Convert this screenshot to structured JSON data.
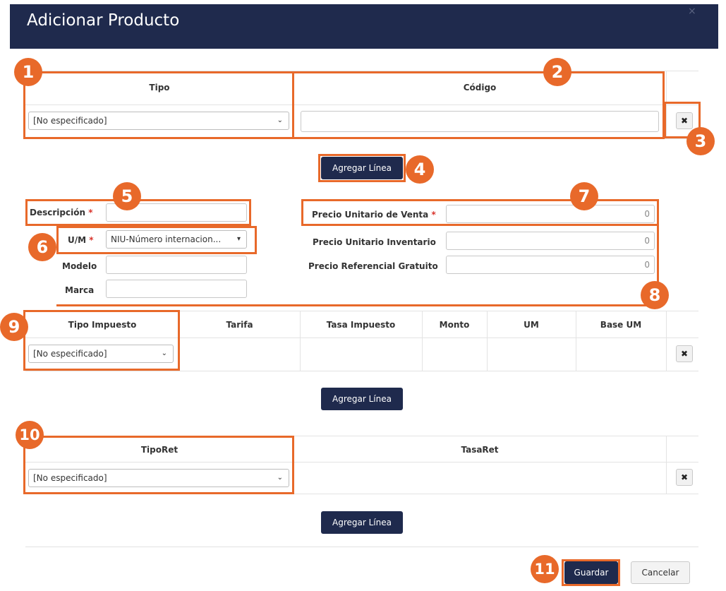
{
  "dialog": {
    "title": "Adicionar Producto",
    "close_label": "×"
  },
  "product_table": {
    "headers": [
      "Tipo",
      "Código"
    ],
    "tipo_value": "[No especificado]",
    "codigo_value": "",
    "remove_label": "✖"
  },
  "add_line_label": "Agregar Línea",
  "form": {
    "descripcion_label": "Descripción",
    "um_label": "U/M",
    "um_value": "NIU-Número internacion...",
    "modelo_label": "Modelo",
    "marca_label": "Marca",
    "precio_venta_label": "Precio Unitario de Venta",
    "precio_venta_value": "0",
    "precio_inventario_label": "Precio Unitario Inventario",
    "precio_inventario_value": "0",
    "precio_gratuito_label": "Precio Referencial Gratuito",
    "precio_gratuito_value": "0",
    "required_mark": "*"
  },
  "tax_table": {
    "headers": [
      "Tipo Impuesto",
      "Tarifa",
      "Tasa Impuesto",
      "Monto",
      "UM",
      "Base UM"
    ],
    "tipo_value": "[No especificado]",
    "remove_label": "✖"
  },
  "ret_table": {
    "headers": [
      "TipoRet",
      "TasaRet"
    ],
    "tipo_value": "[No especificado]",
    "remove_label": "✖"
  },
  "footer": {
    "save_label": "Guardar",
    "cancel_label": "Cancelar"
  },
  "badges": [
    "1",
    "2",
    "3",
    "4",
    "5",
    "6",
    "7",
    "8",
    "9",
    "10",
    "11"
  ],
  "colors": {
    "header": "#1f2a4d",
    "highlight": "#e8692a",
    "required": "#d9332b"
  }
}
